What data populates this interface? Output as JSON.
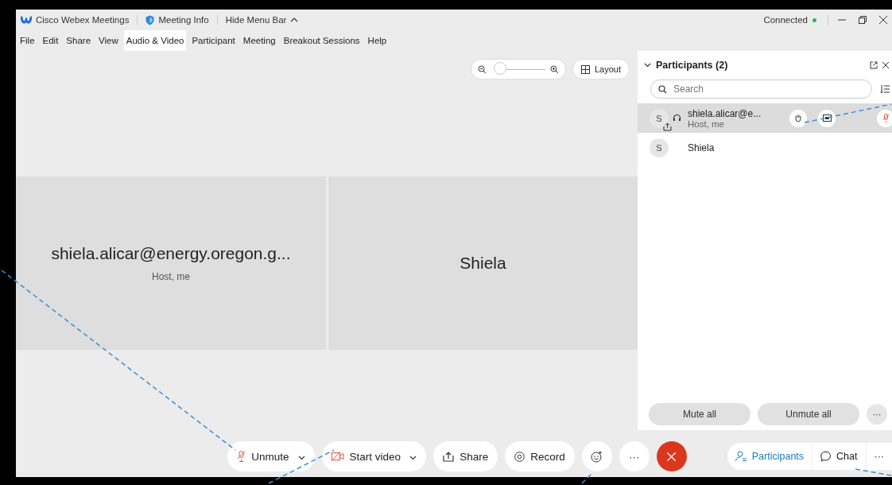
{
  "title_bar": {
    "app_name": "Cisco Webex Meetings",
    "meeting_info": "Meeting Info",
    "hide_menu_bar": "Hide Menu Bar",
    "status": "Connected",
    "connected": true
  },
  "menu": [
    {
      "label": "File",
      "selected": false
    },
    {
      "label": "Edit",
      "selected": false
    },
    {
      "label": "Share",
      "selected": false
    },
    {
      "label": "View",
      "selected": false
    },
    {
      "label": "Audio & Video",
      "selected": true
    },
    {
      "label": "Participant",
      "selected": false
    },
    {
      "label": "Meeting",
      "selected": false
    },
    {
      "label": "Breakout Sessions",
      "selected": false
    },
    {
      "label": "Help",
      "selected": false
    }
  ],
  "view_controls": {
    "zoom": {
      "level": 0.05
    },
    "layout_button": "Layout"
  },
  "tiles": [
    {
      "name": "shiela.alicar@energy.oregon.g...",
      "subtitle": "Host, me"
    },
    {
      "name": "Shiela"
    }
  ],
  "participants_panel": {
    "title": "Participants (2)",
    "search": {
      "placeholder": "Search"
    },
    "participants": [
      {
        "initial": "S",
        "name": "shiela.alicar@e...",
        "subtitle": "Host, me",
        "selected": true,
        "sharing": true,
        "muted": true
      },
      {
        "initial": "S",
        "name": "Shiela",
        "selected": false,
        "sharing": false,
        "muted": false
      }
    ],
    "buttons": [
      "Mute all",
      "Unmute all"
    ],
    "more": "···"
  },
  "toolbar": [
    {
      "kind": "dropdown",
      "label": "Unmute"
    },
    {
      "kind": "dropdown",
      "label": "Start video"
    },
    {
      "kind": "button",
      "label": "Share"
    },
    {
      "kind": "button",
      "label": "Record"
    },
    {
      "kind": "round"
    },
    {
      "kind": "round",
      "label": "···"
    },
    {
      "kind": "end"
    }
  ],
  "side_toolbar": {
    "tabs": [
      {
        "label": "Participants",
        "selected": true
      },
      {
        "label": "Chat",
        "selected": false
      }
    ],
    "more": "···"
  }
}
